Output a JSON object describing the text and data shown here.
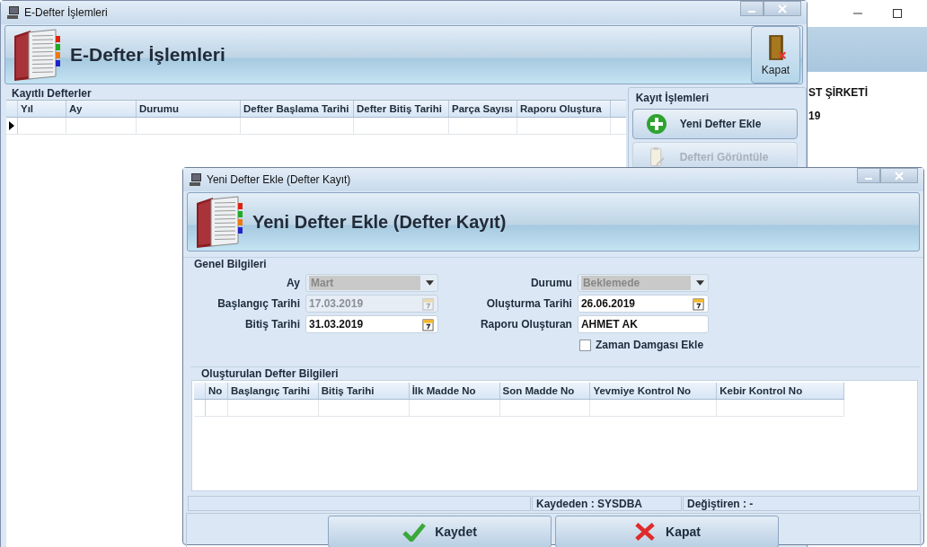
{
  "back_window": {
    "texts": [
      "ST ŞİRKETİ",
      "19"
    ]
  },
  "main_window": {
    "title": "E-Defter İşlemleri",
    "header": "E-Defter İşlemleri",
    "close_button": "Kapat",
    "registered": {
      "title": "Kayıtlı Defterler",
      "columns": [
        {
          "label": "Yıl"
        },
        {
          "label": "Ay"
        },
        {
          "label": "Durumu"
        },
        {
          "label": "Defter Başlama Tarihi"
        },
        {
          "label": "Defter Bitiş Tarihi"
        },
        {
          "label": "Parça Sayısı"
        },
        {
          "label": "Raporu Oluştura"
        }
      ]
    },
    "actions": {
      "title": "Kayıt İşlemleri",
      "buttons": [
        {
          "label": "Yeni Defter Ekle",
          "kind": "add",
          "disabled": false
        },
        {
          "label": "Defteri Görüntüle",
          "kind": "view",
          "disabled": true
        }
      ]
    }
  },
  "dialog": {
    "title": "Yeni Defter Ekle (Defter Kayıt)",
    "header": "Yeni Defter Ekle (Defter Kayıt)",
    "general": {
      "title": "Genel Bilgileri",
      "left_fields": [
        {
          "label": "Ay",
          "kind": "combo",
          "value": "Mart",
          "disabled": true
        },
        {
          "label": "Başlangıç Tarihi",
          "kind": "date",
          "value": "17.03.2019",
          "disabled": true
        },
        {
          "label": "Bitiş Tarihi",
          "kind": "date",
          "value": "31.03.2019",
          "disabled": false
        }
      ],
      "right_fields": [
        {
          "label": "Durumu",
          "kind": "combo",
          "value": "Beklemede",
          "disabled": true
        },
        {
          "label": "Oluşturma Tarihi",
          "kind": "date",
          "value": "26.06.2019",
          "disabled": false
        },
        {
          "label": "Raporu Oluşturan",
          "kind": "text",
          "value": "AHMET AK",
          "disabled": false
        }
      ],
      "timestamp": {
        "label": "Zaman Damgası Ekle",
        "checked": false
      }
    },
    "created": {
      "title": "Oluşturulan Defter Bilgileri",
      "columns": [
        {
          "label": "No"
        },
        {
          "label": "Başlangıç Tarihi"
        },
        {
          "label": "Bitiş Tarihi"
        },
        {
          "label": "İlk Madde No"
        },
        {
          "label": "Son Madde No"
        },
        {
          "label": "Yevmiye Kontrol No"
        },
        {
          "label": "Kebir Kontrol No"
        }
      ]
    },
    "status_bar": [
      "Kaydeden : SYSDBA",
      "Değiştiren :  -"
    ],
    "buttons": [
      {
        "label": "Kaydet",
        "kind": "save"
      },
      {
        "label": "Kapat",
        "kind": "close"
      }
    ]
  }
}
